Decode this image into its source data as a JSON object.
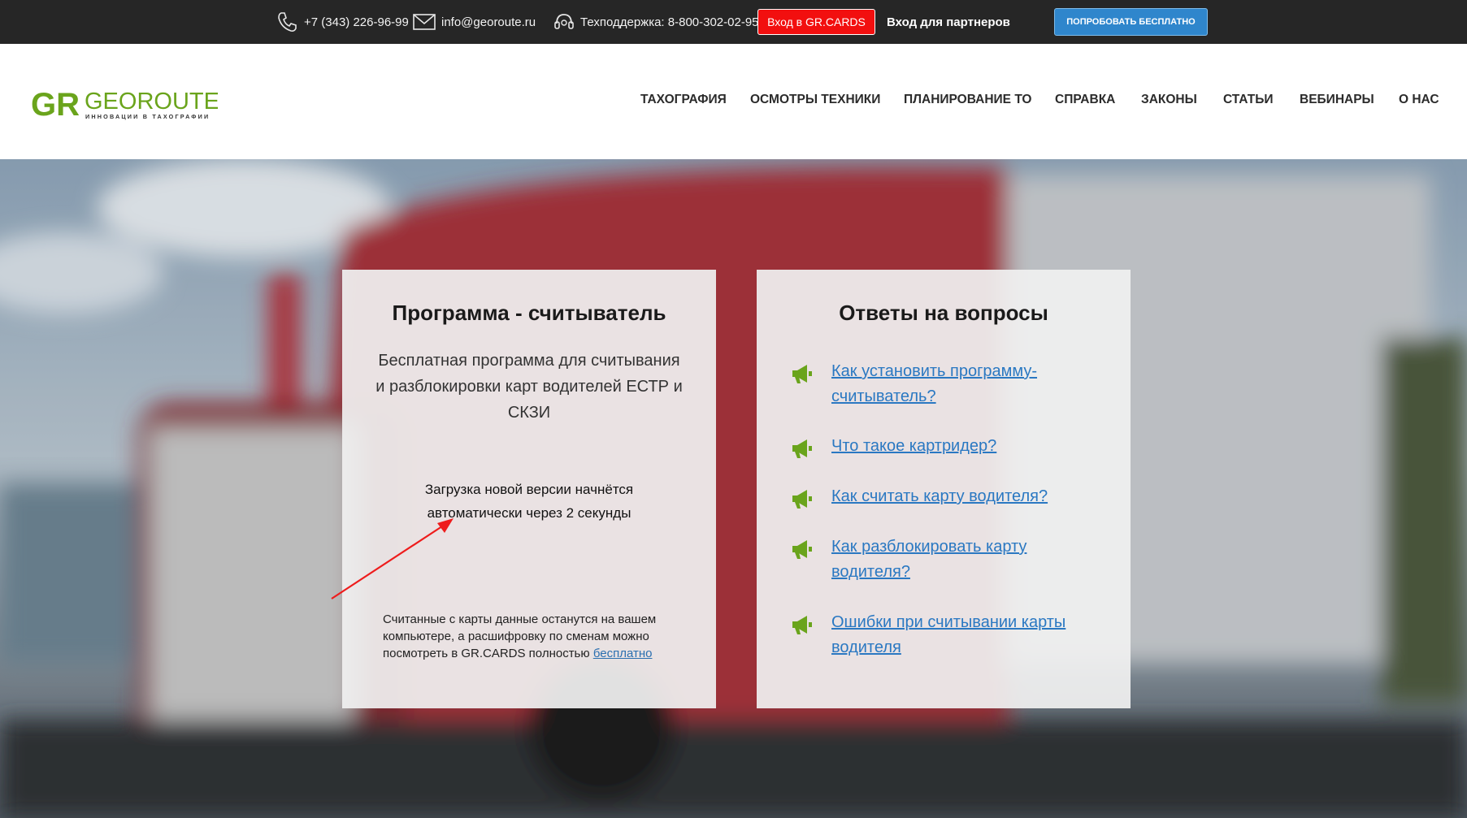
{
  "topbar": {
    "phone": "+7 (343) 226-96-99",
    "email": "info@georoute.ru",
    "support": "Техподдержка: 8-800-302-02-95",
    "login_button": "Вход в GR.CARDS",
    "partners_link": "Вход для партнеров",
    "try_button": "ПОПРОБОВАТЬ БЕСПЛАТНО"
  },
  "logo": {
    "mark": "GR",
    "name": "GEOROUTE",
    "tagline": "ИННОВАЦИИ В ТАХОГРАФИИ"
  },
  "nav": {
    "items": [
      "ТАХОГРАФИЯ",
      "ОСМОТРЫ ТЕХНИКИ",
      "ПЛАНИРОВАНИЕ ТО",
      "СПРАВКА",
      "ЗАКОНЫ",
      "СТАТЬИ",
      "ВЕБИНАРЫ",
      "О НАС"
    ]
  },
  "program_card": {
    "title": "Программа - считыватель",
    "description": "Бесплатная программа для считывания и разблокировки карт водителей ЕСТР и СКЗИ",
    "download_notice": "Загрузка новой версии начнётся автоматически через 2 секунды",
    "footer_text": "Считанные с карты данные останутся на вашем компьютере, а расшифровку по сменам можно посмотреть в GR.CARDS полностью",
    "footer_link": "бесплатно"
  },
  "faq_card": {
    "title": "Ответы на вопросы",
    "items": [
      "Как установить программу-считыватель?",
      "Что такое картридер?",
      "Как считать карту водителя?",
      "Как разблокировать карту водителя?",
      "Ошибки при считывании карты водителя"
    ]
  },
  "colors": {
    "topbar": "#262626",
    "login_red": "#f20f0f",
    "try_blue": "#2f86cc",
    "brand_green": "#6aa41c",
    "link_blue": "#2a78c2"
  }
}
